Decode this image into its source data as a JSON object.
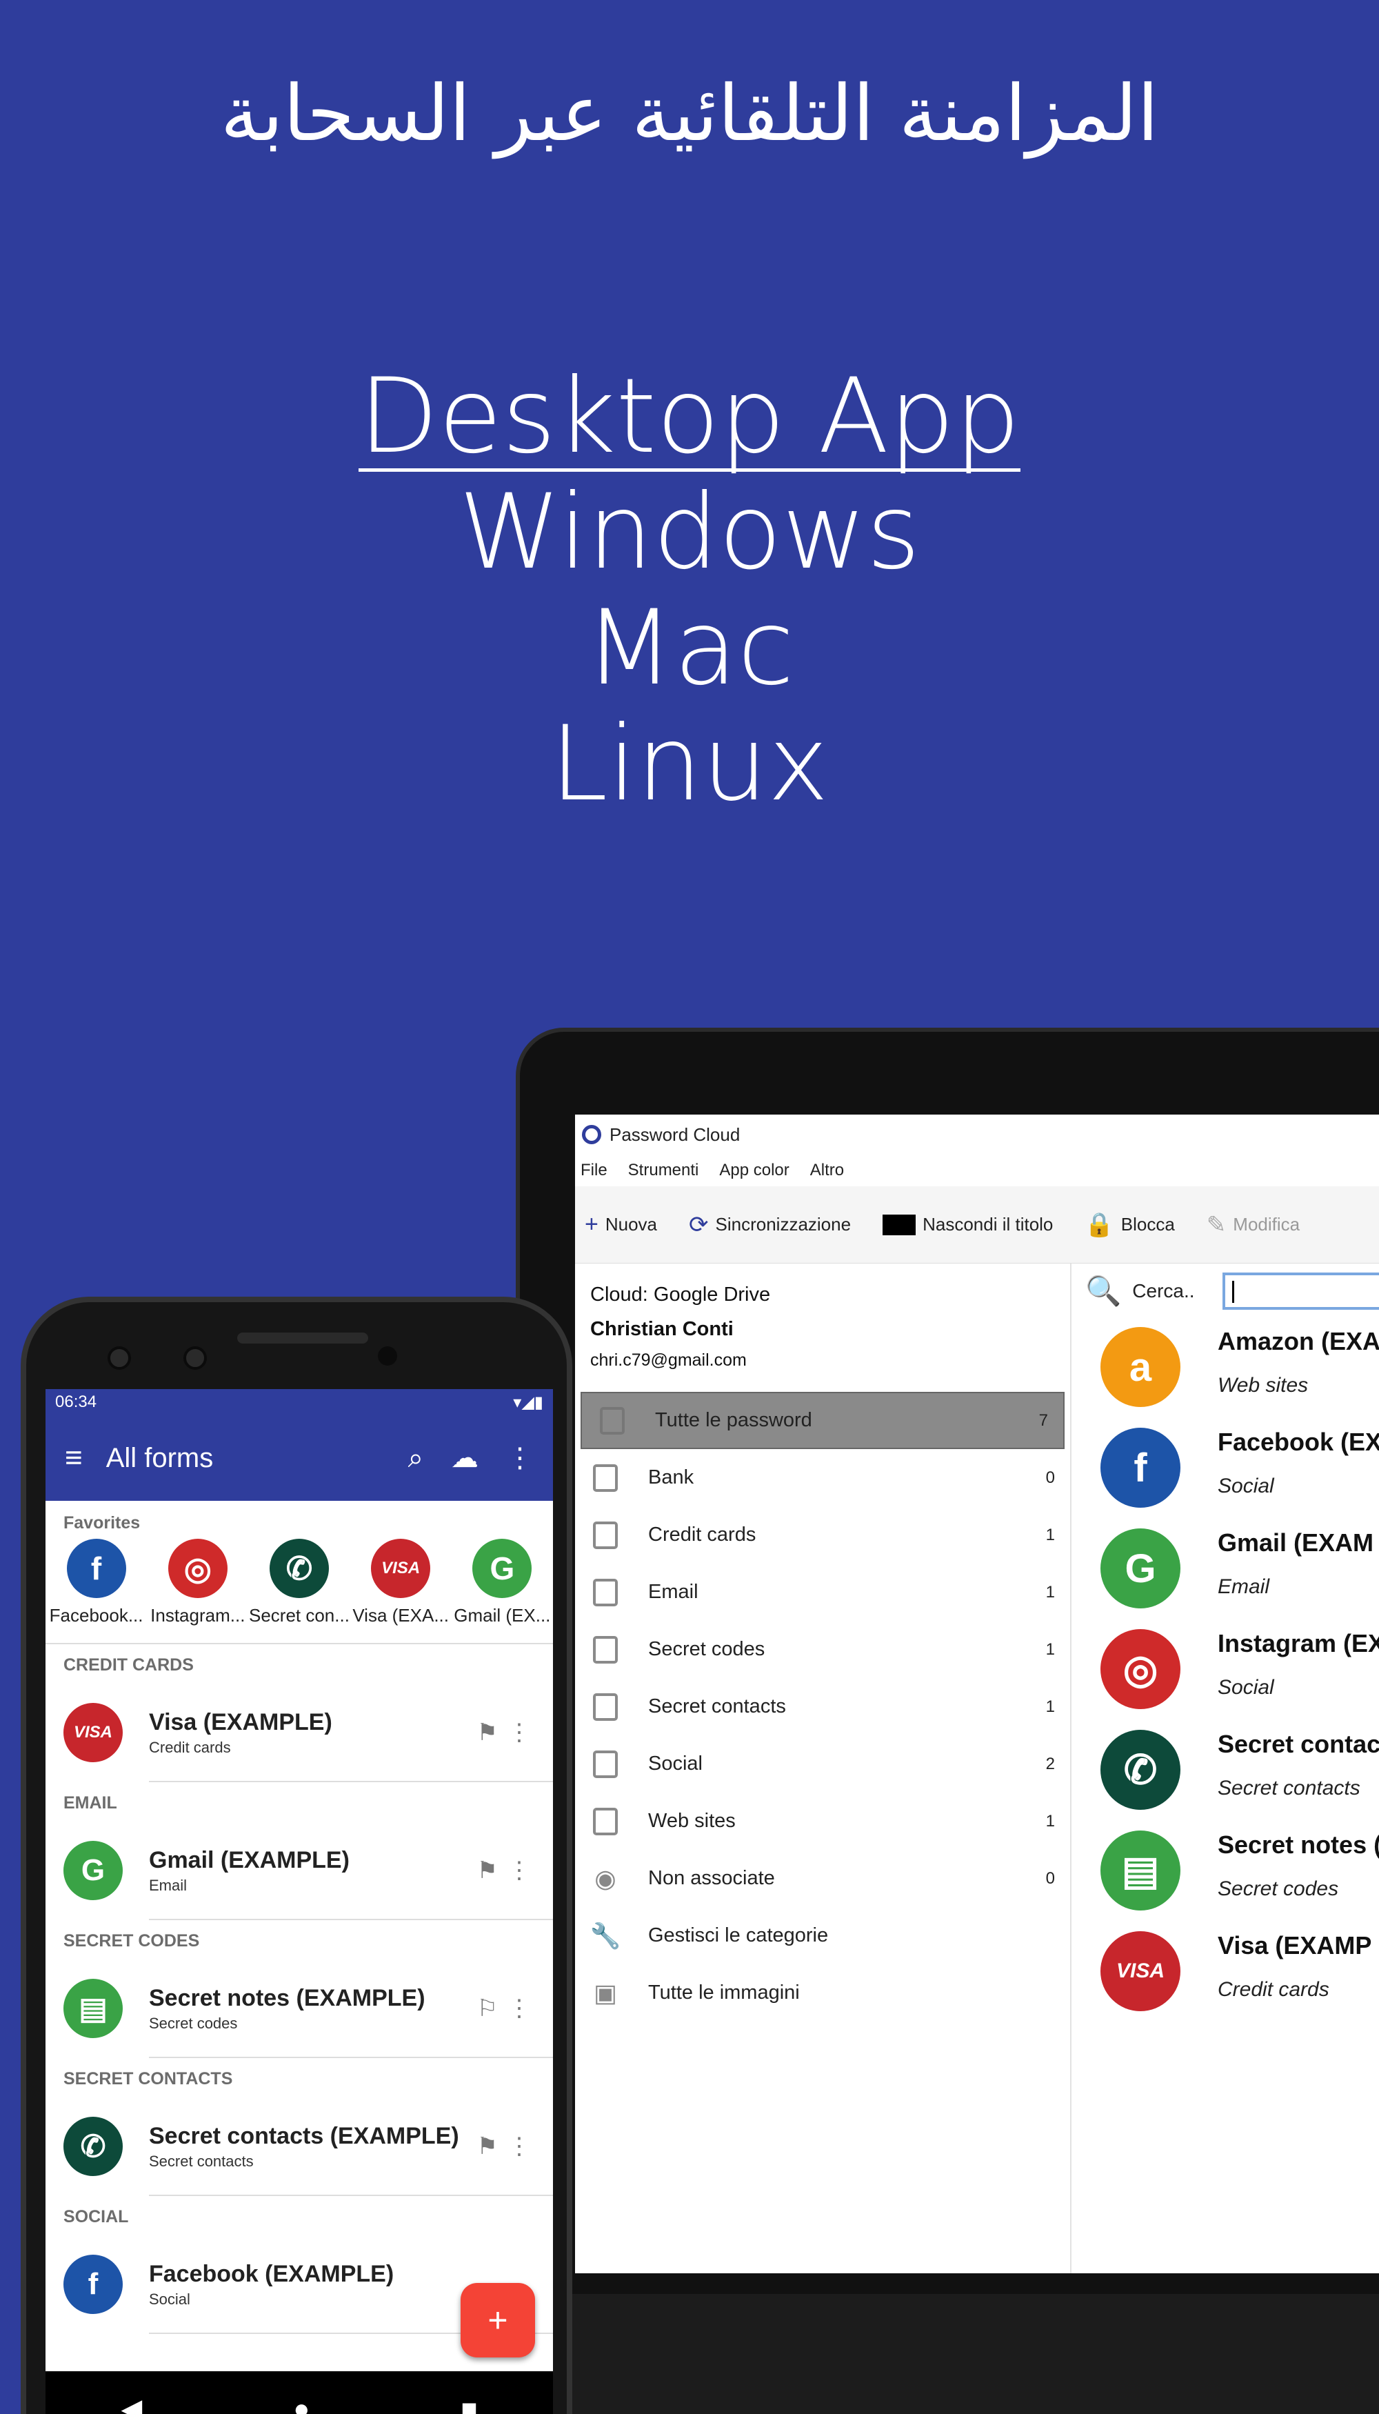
{
  "headline": "المزامنة التلقائية عبر السحابة",
  "platforms": {
    "title": "Desktop App",
    "items": [
      "Windows",
      "Mac",
      "Linux"
    ]
  },
  "desktop": {
    "window_title": "Password Cloud",
    "menu": [
      "File",
      "Strumenti",
      "App color",
      "Altro"
    ],
    "toolbar": {
      "new": "Nuova",
      "sync": "Sincronizzazione",
      "hide_title": "Nascondi il titolo",
      "lock": "Blocca",
      "edit": "Modifica"
    },
    "cloud": "Cloud: Google Drive",
    "user_name": "Christian Conti",
    "user_email": "chri.c79@gmail.com",
    "categories": [
      {
        "label": "Tutte le password",
        "count": "7"
      },
      {
        "label": "Bank",
        "count": "0"
      },
      {
        "label": "Credit cards",
        "count": "1"
      },
      {
        "label": "Email",
        "count": "1"
      },
      {
        "label": "Secret codes",
        "count": "1"
      },
      {
        "label": "Secret contacts",
        "count": "1"
      },
      {
        "label": "Social",
        "count": "2"
      },
      {
        "label": "Web sites",
        "count": "1"
      },
      {
        "label": "Non associate",
        "count": "0"
      }
    ],
    "manage_categories": "Gestisci le categorie",
    "all_images": "Tutte le immagini",
    "search_label": "Cerca..",
    "entries": [
      {
        "title": "Amazon (EXA",
        "sub": "Web sites"
      },
      {
        "title": "Facebook (EX",
        "sub": "Social"
      },
      {
        "title": "Gmail (EXAM",
        "sub": "Email"
      },
      {
        "title": "Instagram (EX",
        "sub": "Social"
      },
      {
        "title": "Secret contac",
        "sub": "Secret contacts"
      },
      {
        "title": "Secret notes (",
        "sub": "Secret codes"
      },
      {
        "title": "Visa (EXAMP",
        "sub": "Credit cards"
      }
    ]
  },
  "phone": {
    "time": "06:34",
    "title": "All forms",
    "favorites_label": "Favorites",
    "favorites": [
      "Facebook...",
      "Instagram...",
      "Secret con...",
      "Visa (EXA...",
      "Gmail (EX..."
    ],
    "groups": [
      {
        "label": "CREDIT CARDS",
        "title": "Visa (EXAMPLE)",
        "sub": "Credit cards"
      },
      {
        "label": "EMAIL",
        "title": "Gmail (EXAMPLE)",
        "sub": "Email"
      },
      {
        "label": "SECRET CODES",
        "title": "Secret notes (EXAMPLE)",
        "sub": "Secret codes"
      },
      {
        "label": "SECRET CONTACTS",
        "title": "Secret contacts (EXAMPLE)",
        "sub": "Secret contacts"
      },
      {
        "label": "SOCIAL",
        "title": "Facebook (EXAMPLE)",
        "sub": "Social"
      }
    ]
  },
  "colors": {
    "background": "#2f3d9c",
    "fab": "#f44336",
    "amazon": "#f39a12",
    "facebook": "#1d54a8",
    "gmail": "#3aa346",
    "instagram": "#cf2a2a",
    "contacts": "#0d4a3a",
    "visa": "#c7262c"
  }
}
